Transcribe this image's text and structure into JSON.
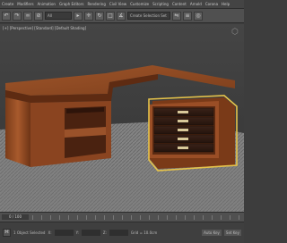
{
  "menu": [
    "Create",
    "Modifiers",
    "Animation",
    "Graph Editors",
    "Rendering",
    "Civil View",
    "Customize",
    "Scripting",
    "Content",
    "Arnold",
    "Corona",
    "Help"
  ],
  "toolbar": {
    "selection_filter": "All",
    "named_selection": "Create Selection Set",
    "buttons": [
      "undo-icon",
      "redo-icon",
      "link-icon",
      "unlink-icon",
      "select-icon",
      "move-icon",
      "rotate-icon",
      "scale-icon",
      "snap-icon",
      "mirror-icon",
      "align-icon",
      "render-icon"
    ]
  },
  "viewport": {
    "label": "[+] [Perspective] [Standard] [Default Shading]",
    "colors": {
      "background": "#3e3e3e",
      "rug": "#8a8a8a",
      "wood": "#8b4a22",
      "selection": "#e6c34a"
    }
  },
  "timeline": {
    "frame_counter": "0 / 100"
  },
  "status": {
    "selected": "1 Object Selected",
    "x": "X:",
    "y": "Y:",
    "z": "Z:",
    "grid": "Grid = 10.0cm",
    "add_time_tag": "Add Time Tag",
    "auto_key": "Auto Key",
    "set_key": "Set Key"
  }
}
